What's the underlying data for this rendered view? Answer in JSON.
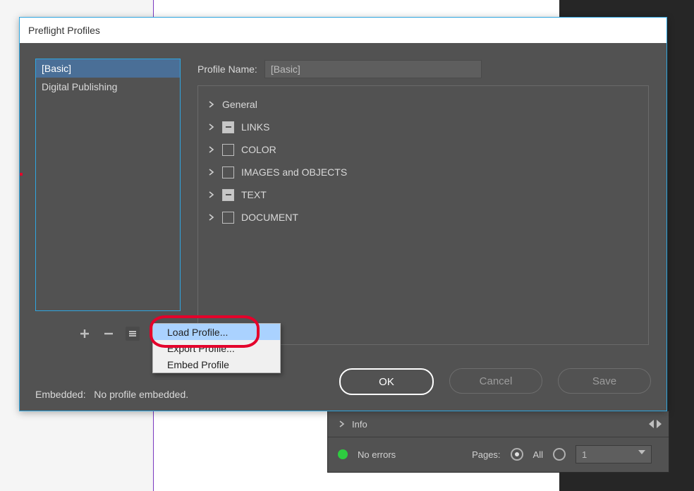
{
  "dialog": {
    "title": "Preflight Profiles",
    "profile_name_label": "Profile Name:",
    "profile_name_value": "[Basic]",
    "embedded_label": "Embedded:",
    "embedded_value": "No profile embedded.",
    "profiles": [
      {
        "label": "[Basic]",
        "selected": true
      },
      {
        "label": "Digital Publishing",
        "selected": false
      }
    ],
    "tree": [
      {
        "label": "General",
        "checkbox": "none"
      },
      {
        "label": "LINKS",
        "checkbox": "partial"
      },
      {
        "label": "COLOR",
        "checkbox": "empty"
      },
      {
        "label": "IMAGES and OBJECTS",
        "checkbox": "empty"
      },
      {
        "label": "TEXT",
        "checkbox": "partial"
      },
      {
        "label": "DOCUMENT",
        "checkbox": "empty"
      }
    ],
    "buttons": {
      "ok": "OK",
      "cancel": "Cancel",
      "save": "Save"
    }
  },
  "menu": {
    "items": [
      {
        "label": "Load Profile...",
        "highlighted": true
      },
      {
        "label": "Export Profile...",
        "highlighted": false
      },
      {
        "label": "Embed Profile",
        "highlighted": false
      }
    ]
  },
  "panel": {
    "info_label": "Info",
    "status": "No errors",
    "pages_label": "Pages:",
    "all_label": "All",
    "page_value": "1"
  }
}
